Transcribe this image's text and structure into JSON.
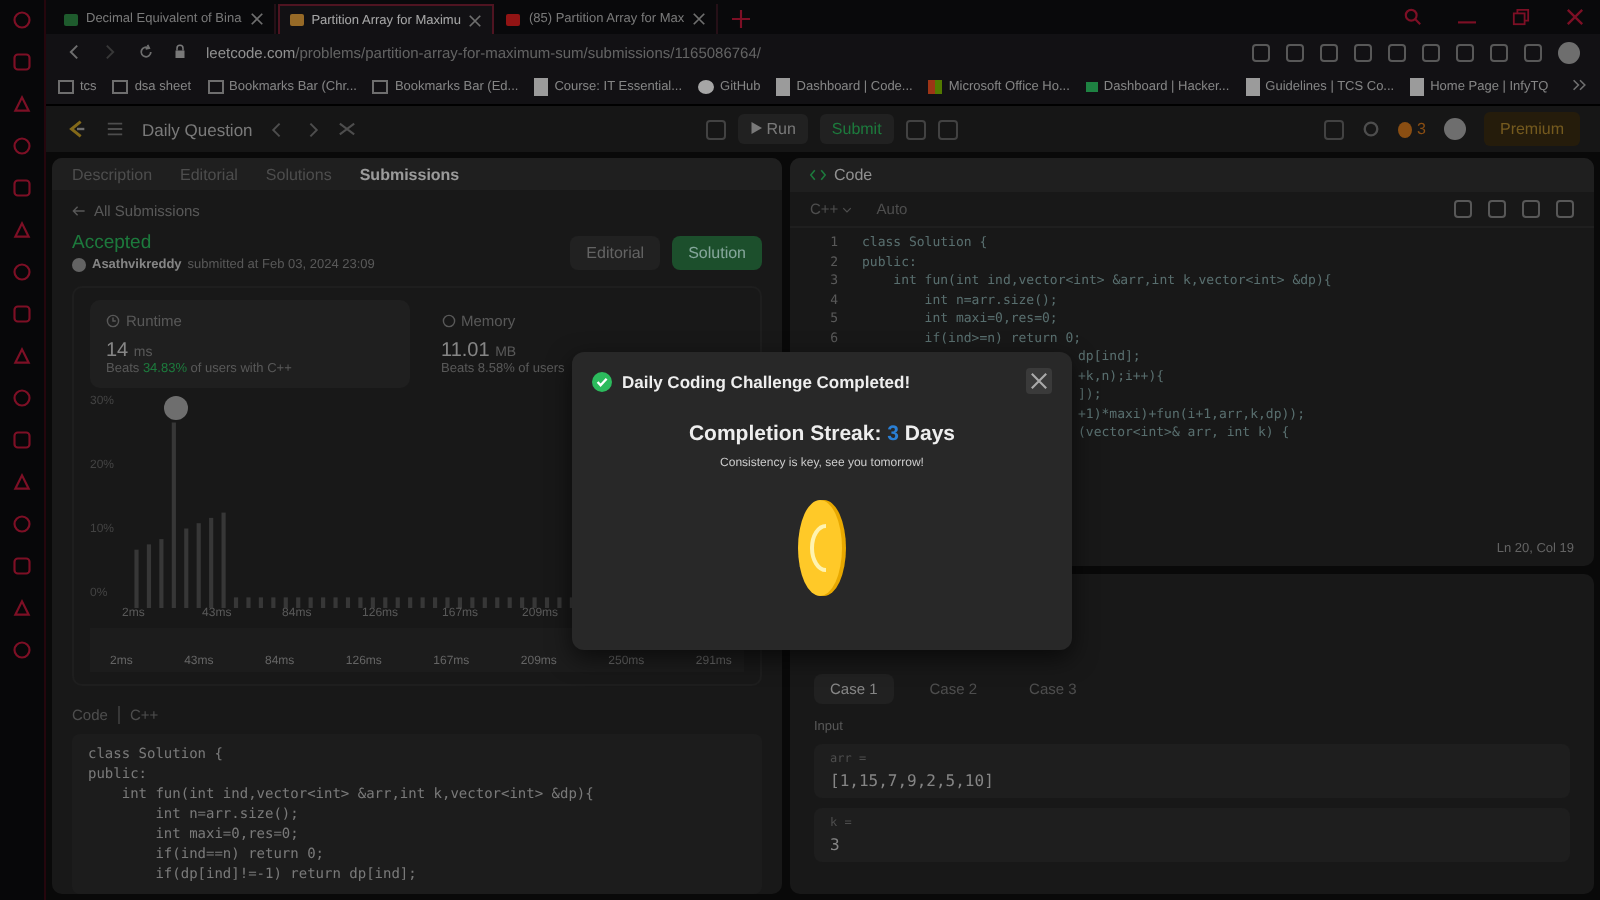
{
  "browser_tabs": [
    {
      "title": "Decimal Equivalent of Bina",
      "selected": false,
      "kind": "gfg"
    },
    {
      "title": "Partition Array for Maximu",
      "selected": true,
      "kind": "leetcode"
    },
    {
      "title": "(85) Partition Array for Max",
      "selected": false,
      "kind": "youtube"
    }
  ],
  "address_bar": {
    "host": "leetcode.com",
    "path": "/problems/partition-array-for-maximum-sum/submissions/1165086764/"
  },
  "bookmarks": [
    {
      "label": "tcs",
      "kind": "folder"
    },
    {
      "label": "dsa sheet",
      "kind": "folder"
    },
    {
      "label": "Bookmarks Bar (Chr...",
      "kind": "folder"
    },
    {
      "label": "Bookmarks Bar (Ed...",
      "kind": "folder"
    },
    {
      "label": "Course: IT Essential...",
      "kind": "page"
    },
    {
      "label": "GitHub",
      "kind": "github"
    },
    {
      "label": "Dashboard | Code...",
      "kind": "page"
    },
    {
      "label": "Microsoft Office Ho...",
      "kind": "office"
    },
    {
      "label": "Dashboard | Hacker...",
      "kind": "hacker"
    },
    {
      "label": "Guidelines | TCS Co...",
      "kind": "page"
    },
    {
      "label": "Home Page | InfyTQ",
      "kind": "page"
    }
  ],
  "top_nav": {
    "title": "Daily Question",
    "run": "Run",
    "submit": "Submit",
    "streak": "3",
    "premium": "Premium"
  },
  "left_panel": {
    "tabs": [
      {
        "label": "Description",
        "selected": false
      },
      {
        "label": "Editorial",
        "selected": false
      },
      {
        "label": "Solutions",
        "selected": false
      },
      {
        "label": "Submissions",
        "selected": true
      }
    ],
    "back_link": "All Submissions",
    "status": "Accepted",
    "user": "Asathvikreddy",
    "submitted": "submitted at Feb 03, 2024 23:09",
    "editorial_button": "Editorial",
    "solution_button": "Solution",
    "runtime": {
      "label": "Runtime",
      "value": "14",
      "unit": "ms",
      "beats": "Beats",
      "percent": "34.83%",
      "rest": "of users with C++"
    },
    "memory": {
      "label": "Memory",
      "value": "11.01",
      "unit": "MB",
      "text": "Beats 8.58% of users"
    },
    "y_ticks": [
      "30%",
      "20%",
      "10%",
      "0%"
    ],
    "x_ticks": [
      "2ms",
      "43ms",
      "84ms",
      "126ms",
      "167ms",
      "209ms"
    ],
    "mini_ticks": [
      "2ms",
      "43ms",
      "84ms",
      "126ms",
      "167ms",
      "209ms",
      "250ms",
      "291ms"
    ],
    "code_label": "Code",
    "code_lang": "C++",
    "code": [
      "class Solution {",
      "public:",
      "    int fun(int ind,vector<int> &arr,int k,vector<int> &dp){",
      "        int n=arr.size();",
      "        int maxi=0,res=0;",
      "        if(ind==n) return 0;",
      "        if(dp[ind]!=-1) return dp[ind];"
    ]
  },
  "editor": {
    "title": "Code",
    "language": "C++",
    "mode": "Auto",
    "lines": [
      {
        "number": "1",
        "text": "class Solution {"
      },
      {
        "number": "2",
        "text": "public:"
      },
      {
        "number": "3",
        "text": "    int fun(int ind,vector<int> &arr,int k,vector<int> &dp){"
      },
      {
        "number": "4",
        "text": "        int n=arr.size();"
      },
      {
        "number": "5",
        "text": "        int maxi=0,res=0;"
      },
      {
        "number": "6",
        "text": "        if(ind>=n) return 0;"
      },
      {
        "fragment": "dp[ind];"
      },
      {
        "fragment": "+k,n);i++){"
      },
      {
        "fragment": "]);"
      },
      {
        "fragment": "+1)*maxi)+fun(i+1,arr,k,dp));"
      },
      {
        "fragment": "(vector<int>& arr, int k) {"
      }
    ],
    "cursor": "Ln 20, Col 19"
  },
  "testcases": {
    "cases": [
      {
        "label": "Case 1",
        "selected": true
      },
      {
        "label": "Case 2",
        "selected": false
      },
      {
        "label": "Case 3",
        "selected": false
      }
    ],
    "input_label": "Input",
    "params": [
      {
        "name": "arr =",
        "value": "[1,15,7,9,2,5,10]"
      },
      {
        "name": "k =",
        "value": "3"
      }
    ]
  },
  "modal": {
    "title": "Daily Coding Challenge Completed!",
    "streak_prefix": "Completion Streak:",
    "streak_days": "3",
    "streak_suffix": "Days",
    "message": "Consistency is key, see you tomorrow!"
  }
}
